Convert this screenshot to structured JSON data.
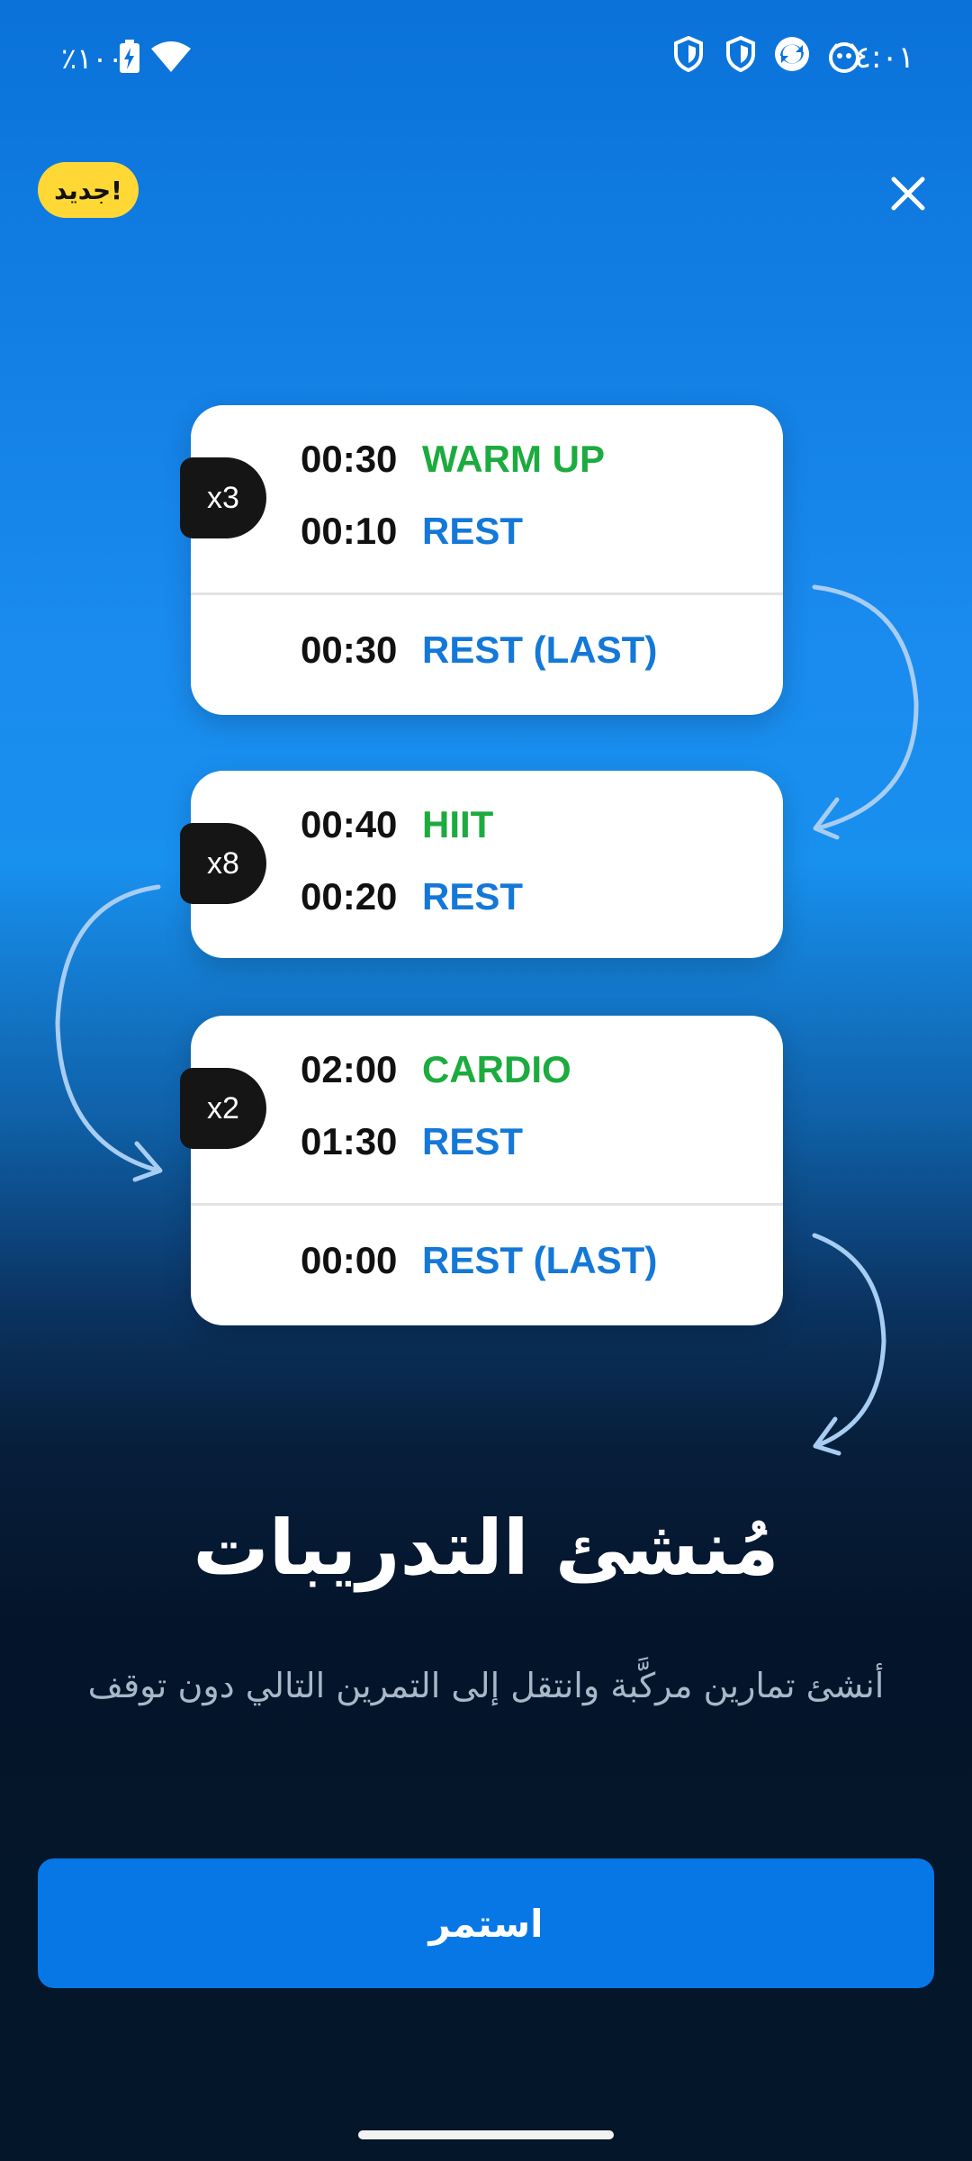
{
  "status_bar": {
    "time": "٤:٠١",
    "battery": "٪١٠٠",
    "icons": [
      "face-icon",
      "sync-icon",
      "shield-icon",
      "shield-icon",
      "wifi-icon",
      "battery-charging-icon"
    ]
  },
  "header": {
    "badge": "جديد!",
    "close_icon": "close-icon"
  },
  "cards": [
    {
      "reps": "x3",
      "rows": [
        {
          "time": "00:30",
          "label": "WARM UP",
          "color": "#1cab3f"
        },
        {
          "time": "00:10",
          "label": "REST",
          "color": "#1478d8"
        }
      ],
      "footer": {
        "time": "00:30",
        "label": "REST (LAST)",
        "color": "#1478d8"
      }
    },
    {
      "reps": "x8",
      "rows": [
        {
          "time": "00:40",
          "label": "HIIT",
          "color": "#1cab3f"
        },
        {
          "time": "00:20",
          "label": "REST",
          "color": "#1478d8"
        }
      ]
    },
    {
      "reps": "x2",
      "rows": [
        {
          "time": "02:00",
          "label": "CARDIO",
          "color": "#1cab3f"
        },
        {
          "time": "01:30",
          "label": "REST",
          "color": "#1478d8"
        }
      ],
      "footer": {
        "time": "00:00",
        "label": "REST (LAST)",
        "color": "#1478d8"
      }
    }
  ],
  "title": "مُنشئ التدريبات",
  "subtitle": "أنشئ تمارين مركَّبة وانتقل إلى التمرين التالي دون توقف",
  "continue_button": "استمر",
  "colors": {
    "accent": "#0877e6",
    "badge": "#ffd835",
    "work": "#1cab3f",
    "rest": "#1478d8"
  }
}
